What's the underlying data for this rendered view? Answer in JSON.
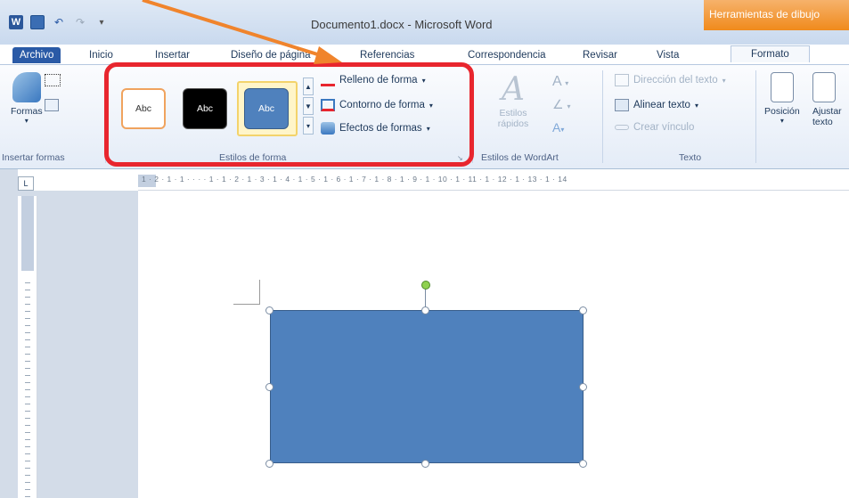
{
  "window": {
    "title": "Documento1.docx - Microsoft Word",
    "contextual_tab_group": "Herramientas de dibujo"
  },
  "tabs": [
    "Archivo",
    "Inicio",
    "Insertar",
    "Diseño de página",
    "Referencias",
    "Correspondencia",
    "Revisar",
    "Vista",
    "Formato"
  ],
  "ribbon": {
    "insert_shapes": {
      "button": "Formas",
      "group_label": "Insertar formas"
    },
    "shape_styles": {
      "swatch_label": "Abc",
      "commands": [
        "Relleno de forma",
        "Contorno de forma",
        "Efectos de formas"
      ],
      "group_label": "Estilos de forma"
    },
    "wordart": {
      "button": "Estilos rápidos",
      "group_label": "Estilos de WordArt"
    },
    "text": {
      "commands": [
        "Dirección del texto",
        "Alinear texto",
        "Crear vínculo"
      ],
      "group_label": "Texto"
    },
    "arrange": {
      "position": "Posición",
      "wrap": "Ajustar texto"
    }
  },
  "ruler": {
    "horizontal_labels": "1 · 2 · 1 · 1 · · · · 1 · 1 · 2 · 1 · 3 · 1 · 4 · 1 · 5 · 1 · 6 · 1 · 7 · 1 · 8 · 1 · 9 · 1 · 10 · 1 · 11 · 1 · 12 · 1 · 13 · 1 · 14"
  },
  "colors": {
    "shape_fill": "#4f81bd",
    "highlight_border": "#e8262e",
    "pointer_arrow": "#f0842c",
    "contextual_tab": "#f08a1c"
  }
}
